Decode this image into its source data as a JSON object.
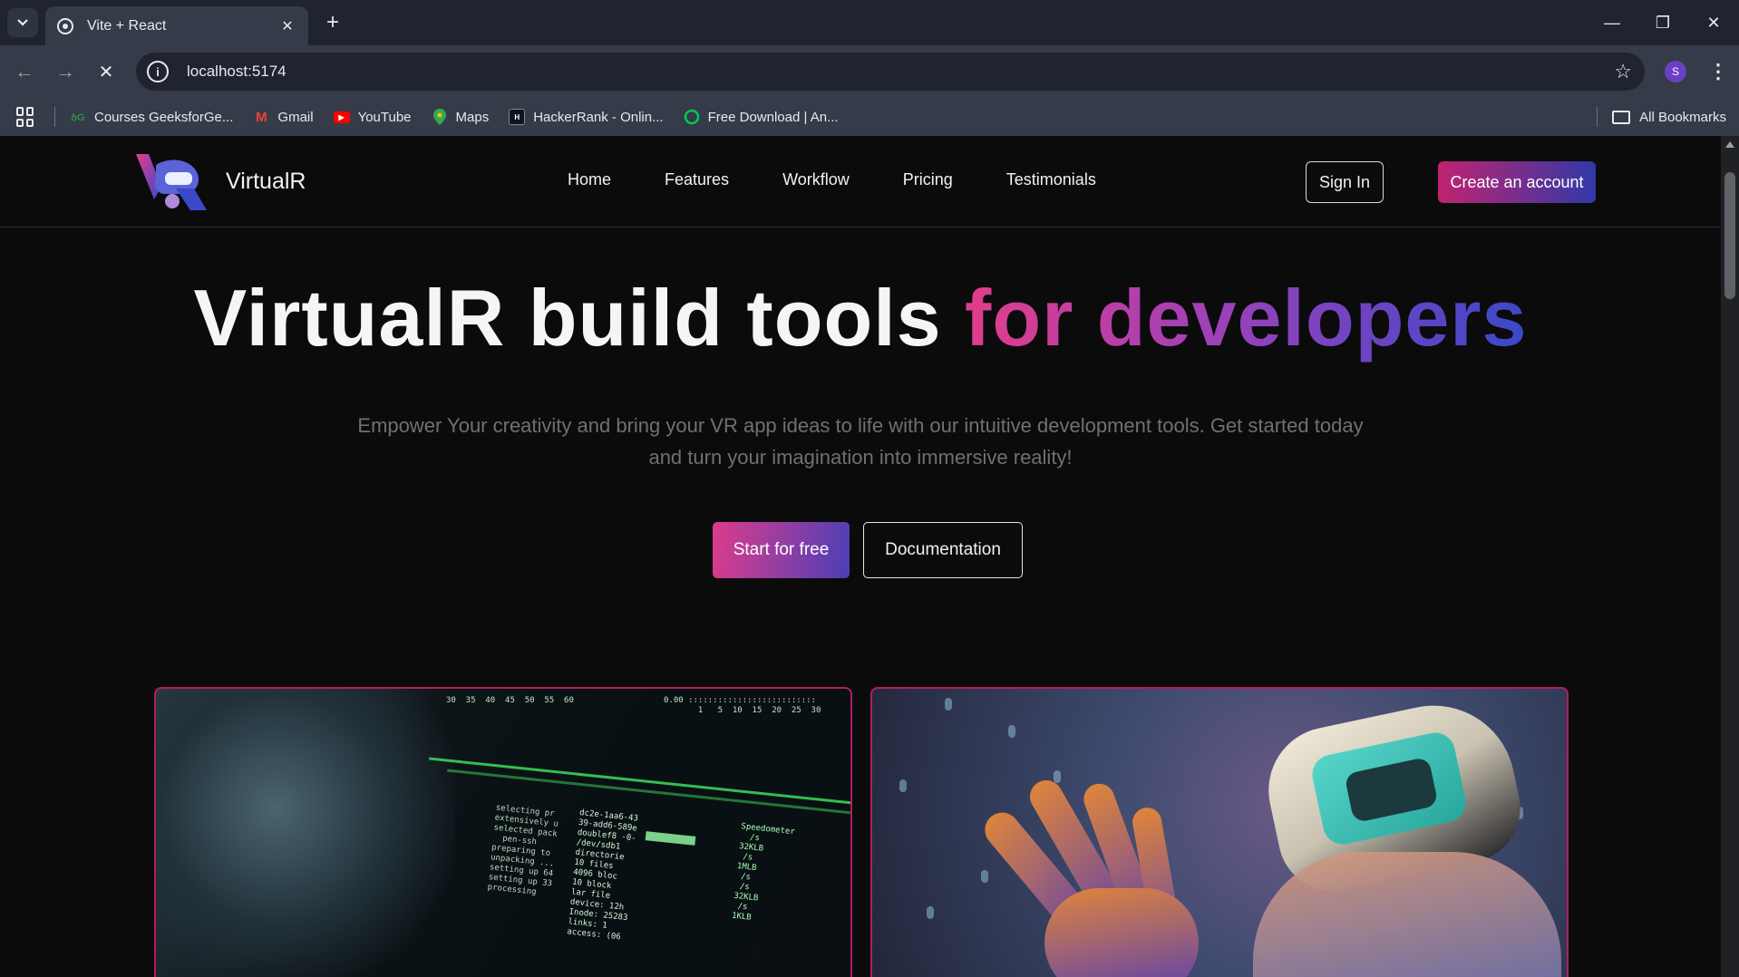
{
  "browser": {
    "tab": {
      "title": "Vite + React"
    },
    "url": "localhost:5174",
    "profile_initial": "S",
    "bookmarks": [
      {
        "label": "Courses GeeksforGe...",
        "icon": "geeksforgeeks-icon",
        "color": "#2f8d46"
      },
      {
        "label": "Gmail",
        "icon": "gmail-icon",
        "color": "#ea4335"
      },
      {
        "label": "YouTube",
        "icon": "youtube-icon",
        "color": "#ff0000"
      },
      {
        "label": "Maps",
        "icon": "maps-icon",
        "color": "#34a853"
      },
      {
        "label": "HackerRank - Onlin...",
        "icon": "hackerrank-icon",
        "color": "#1ba94c"
      },
      {
        "label": "Free Download | An...",
        "icon": "download-site-icon",
        "color": "#00c853"
      }
    ],
    "all_bookmarks_label": "All Bookmarks"
  },
  "site": {
    "brand": "VirtualR",
    "nav": [
      "Home",
      "Features",
      "Workflow",
      "Pricing",
      "Testimonials"
    ],
    "sign_in": "Sign In",
    "create_account": "Create an account",
    "hero": {
      "title_plain": "VirtualR build tools ",
      "title_gradient": "for developers",
      "subtitle": "Empower Your creativity and bring your VR app ideas to life with our intuitive development tools. Get started today and turn your imagination into immersive reality!",
      "primary_cta": "Start for free",
      "secondary_cta": "Documentation"
    },
    "colors": {
      "accent_pink": "#dd3c8c",
      "accent_blue": "#3a48c9",
      "card_border": "#b01e62"
    }
  }
}
